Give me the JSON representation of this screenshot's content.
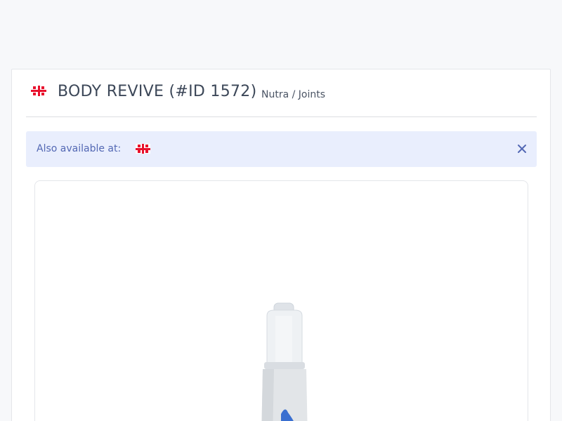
{
  "offer": {
    "title": "BODY REVIVE (#ID 1572)",
    "category": "Nutra / Joints",
    "country_flag": "georgia-flag-icon"
  },
  "alert": {
    "text": "Also available at:",
    "flag": "georgia-flag-icon",
    "close_icon": "close-icon"
  },
  "product": {
    "image": "product-bottle"
  },
  "colors": {
    "accent": "#5368b4",
    "alert_bg": "#e9eefd",
    "flag_red": "#e8112d",
    "title": "#3c4758"
  }
}
